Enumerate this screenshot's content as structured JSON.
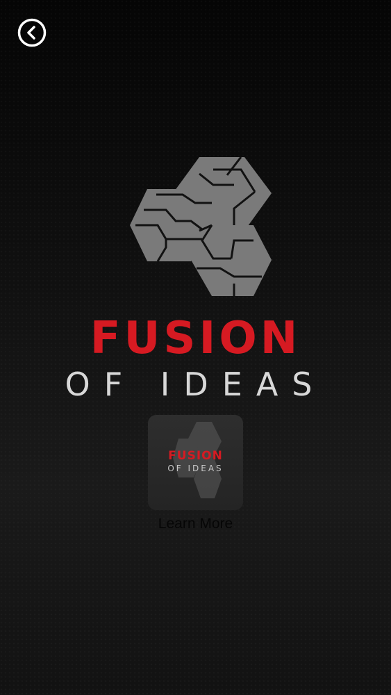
{
  "header": {
    "back_icon": "chevron-left-circle-icon"
  },
  "brand": {
    "logo_icon": "hexagon-cluster-logo-icon",
    "title": "FUSION",
    "subtitle": "OF IDEAS"
  },
  "learn_more": {
    "thumbnail_title": "FUSION",
    "thumbnail_subtitle": "OF IDEAS",
    "label": "Learn More"
  },
  "colors": {
    "brand_red": "#d61a22",
    "logo_gray": "#7a7a7a",
    "background": "#101010"
  }
}
